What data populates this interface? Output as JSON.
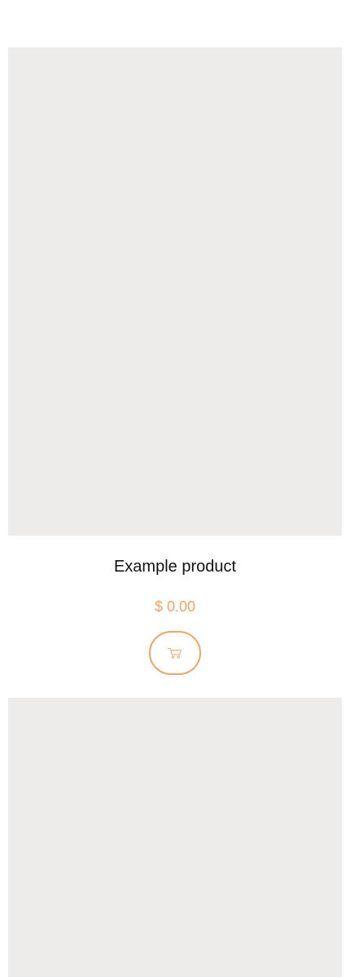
{
  "products": [
    {
      "title": "Example product",
      "price": "$ 0.00",
      "cart_icon": "shopping-cart-icon"
    },
    {
      "title": "",
      "price": "",
      "cart_icon": "shopping-cart-icon"
    }
  ],
  "colors": {
    "accent": "#f0a561",
    "image_placeholder": "#edecea",
    "text": "#111111",
    "background": "#ffffff"
  }
}
